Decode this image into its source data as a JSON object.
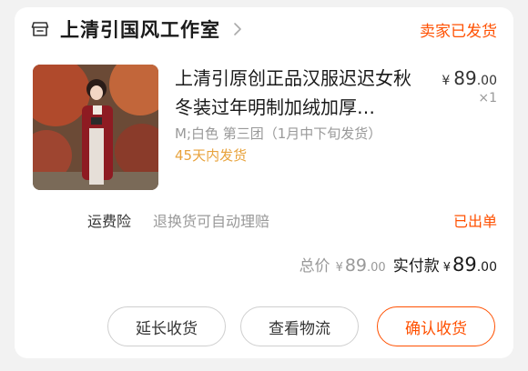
{
  "shop": {
    "name": "上清引国风工作室",
    "icon": "store-icon"
  },
  "order": {
    "status": "卖家已发货"
  },
  "item": {
    "title": "上清引原创正品汉服迟迟女秋冬装过年明制加绒加厚…",
    "price_symbol": "¥",
    "price_int": "89",
    "price_dec": ".00",
    "quantity": "×1",
    "sku": "M;白色 第三团（1月中下旬发货）",
    "ship_note": "45天内发货"
  },
  "insurance": {
    "label": "运费险",
    "desc": "退换货可自动理赔",
    "status": "已出单"
  },
  "totals": {
    "total_label": "总价",
    "total_symbol": "¥",
    "total_int": "89",
    "total_dec": ".00",
    "paid_label": "实付款",
    "paid_symbol": "¥",
    "paid_int": "89",
    "paid_dec": ".00"
  },
  "buttons": {
    "extend": "延长收货",
    "logistics": "查看物流",
    "confirm": "确认收货"
  },
  "colors": {
    "accent": "#ff5000",
    "ship_note": "#e8a33d"
  }
}
